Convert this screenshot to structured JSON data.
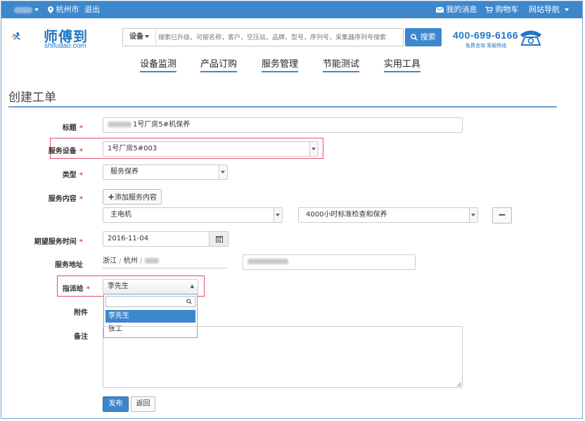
{
  "topbar": {
    "user_menu": "",
    "city": "杭州市",
    "logout": "退出",
    "messages": "我的消息",
    "cart": "购物车",
    "site_nav": "网站导航"
  },
  "header": {
    "brand_name": "师傅到",
    "brand_domain": "shifudao.com",
    "search_category": "设备",
    "search_placeholder": "搜索已升级，可按名称，客户，空压站，品牌，型号，序列号，采集器序列号搜索",
    "search_button": "搜索",
    "hotline": "400-699-6166",
    "hotline_note": "免费咨询 客服热线"
  },
  "nav": [
    {
      "label": "设备监测"
    },
    {
      "label": "产品订购"
    },
    {
      "label": "服务管理"
    },
    {
      "label": "节能测试"
    },
    {
      "label": "实用工具"
    }
  ],
  "page": {
    "title": "创建工单"
  },
  "form": {
    "title_label": "标题",
    "title_value": "1号厂房5#机保养",
    "device_label": "服务设备",
    "device_value": "1号厂房5#003",
    "type_label": "类型",
    "type_value": "服务保养",
    "content_label": "服务内容",
    "add_content_button": "添加服务内容",
    "content_item": "主电机",
    "content_task": "4000小时标准检查和保养",
    "remove_button": "−",
    "date_label": "期望服务时间",
    "date_value": "2016-11-04",
    "address_label": "服务地址",
    "address_province": "浙江",
    "address_city": "杭州",
    "assign_label": "指派给",
    "assign_value": "李先生",
    "assign_options": [
      "李先生",
      "张工"
    ],
    "attachment_label": "附件",
    "remark_label": "备注",
    "submit_button": "发布",
    "back_button": "返回",
    "required_mark": "*"
  },
  "colors": {
    "primary": "#3d87cd",
    "brand": "#1f75c4",
    "required": "#d9534f",
    "highlight": "#e2506a"
  }
}
